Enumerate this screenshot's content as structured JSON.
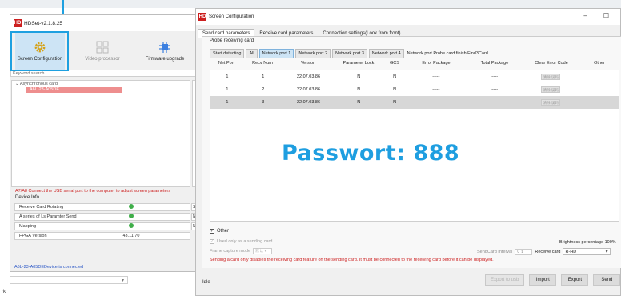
{
  "hdset": {
    "logo": "HD",
    "title": "HDSet-v2.1.8.25",
    "tools": [
      {
        "label": "Screen Configuration",
        "icon": "gear-icon"
      },
      {
        "label": "Video processor",
        "icon": "video-processor-icon"
      },
      {
        "label": "Firmware upgrade",
        "icon": "chip-icon"
      }
    ],
    "search_placeholder": "Keyword search",
    "tree_group": "Asynchronous card",
    "tree_item": "A6L-23-A05DE",
    "tree_side_char": "S",
    "usb_message": "A7/A8 Connect the USB serial port to the computer to adjust screen parameters",
    "device_info_label": "Device Info",
    "info_rows": [
      {
        "label": "Receive Card Rotating",
        "value": "",
        "ok": true
      },
      {
        "label": "A series of Ls Paramter Send",
        "value": "",
        "ok": true
      },
      {
        "label": "Mapping",
        "value": "",
        "ok": true
      },
      {
        "label": "FPGA Version",
        "value": "43.11.70",
        "ok": false
      }
    ],
    "side_cut_labels": [
      "Spec",
      "Net P",
      "New"
    ],
    "status_text": "A6L-23-A05DEDevice is connected",
    "partial_text": "rk"
  },
  "screen_config": {
    "logo": "HD",
    "title": "Screen Configuration",
    "window_buttons": [
      "–",
      "☐"
    ],
    "tabs": [
      "Send card parameters",
      "Receive card parameters",
      "Connection settings(Look from front)"
    ],
    "probe_label": "Probe receiving card",
    "probe_buttons": [
      "Start detecting",
      "All",
      "Network port 1",
      "Network port 2",
      "Network port 3",
      "Network port 4"
    ],
    "probe_status": "Network port Probe card finish.Find3Card",
    "columns": [
      "Net Port",
      "Recv Num",
      "Version",
      "Parameter Lock",
      "GCS",
      "Error Package",
      "Total Package",
      "Clear Error Code",
      "Other"
    ],
    "rows": [
      [
        "1",
        "1",
        "22.07.03.86",
        "N",
        "N",
        "-----",
        "-----",
        "清除 误码",
        ""
      ],
      [
        "1",
        "2",
        "22.07.03.86",
        "N",
        "N",
        "-----",
        "-----",
        "清除 误码",
        ""
      ],
      [
        "1",
        "3",
        "22.07.03.86",
        "N",
        "N",
        "-----",
        "-----",
        "清除 误码",
        ""
      ]
    ],
    "password_overlay": "Passwort: 888",
    "other_label": "Other",
    "used_label": "Used only as a sending card",
    "brightness_label": "Brightness percentage",
    "brightness_value": "100%",
    "frame_label": "Frame capture mode",
    "frame_value": "默认",
    "interval_label": "SendCard Interval",
    "interval_value": "0",
    "receive_card_label": "Receive card",
    "receive_card_value": "R-HD",
    "warning": "Sending a card only disables the receiving card feature on the sending card. It must be connected to the receiving card before it can be displayed.",
    "status": "Idle",
    "bottom_buttons": [
      "Export to usb",
      "Import",
      "Export",
      "Send"
    ]
  },
  "colors": {
    "accent": "#1ea0e0",
    "danger": "#cc1f1f",
    "selected_row": "#d7d7d7",
    "selection": "#ee8e8e"
  }
}
